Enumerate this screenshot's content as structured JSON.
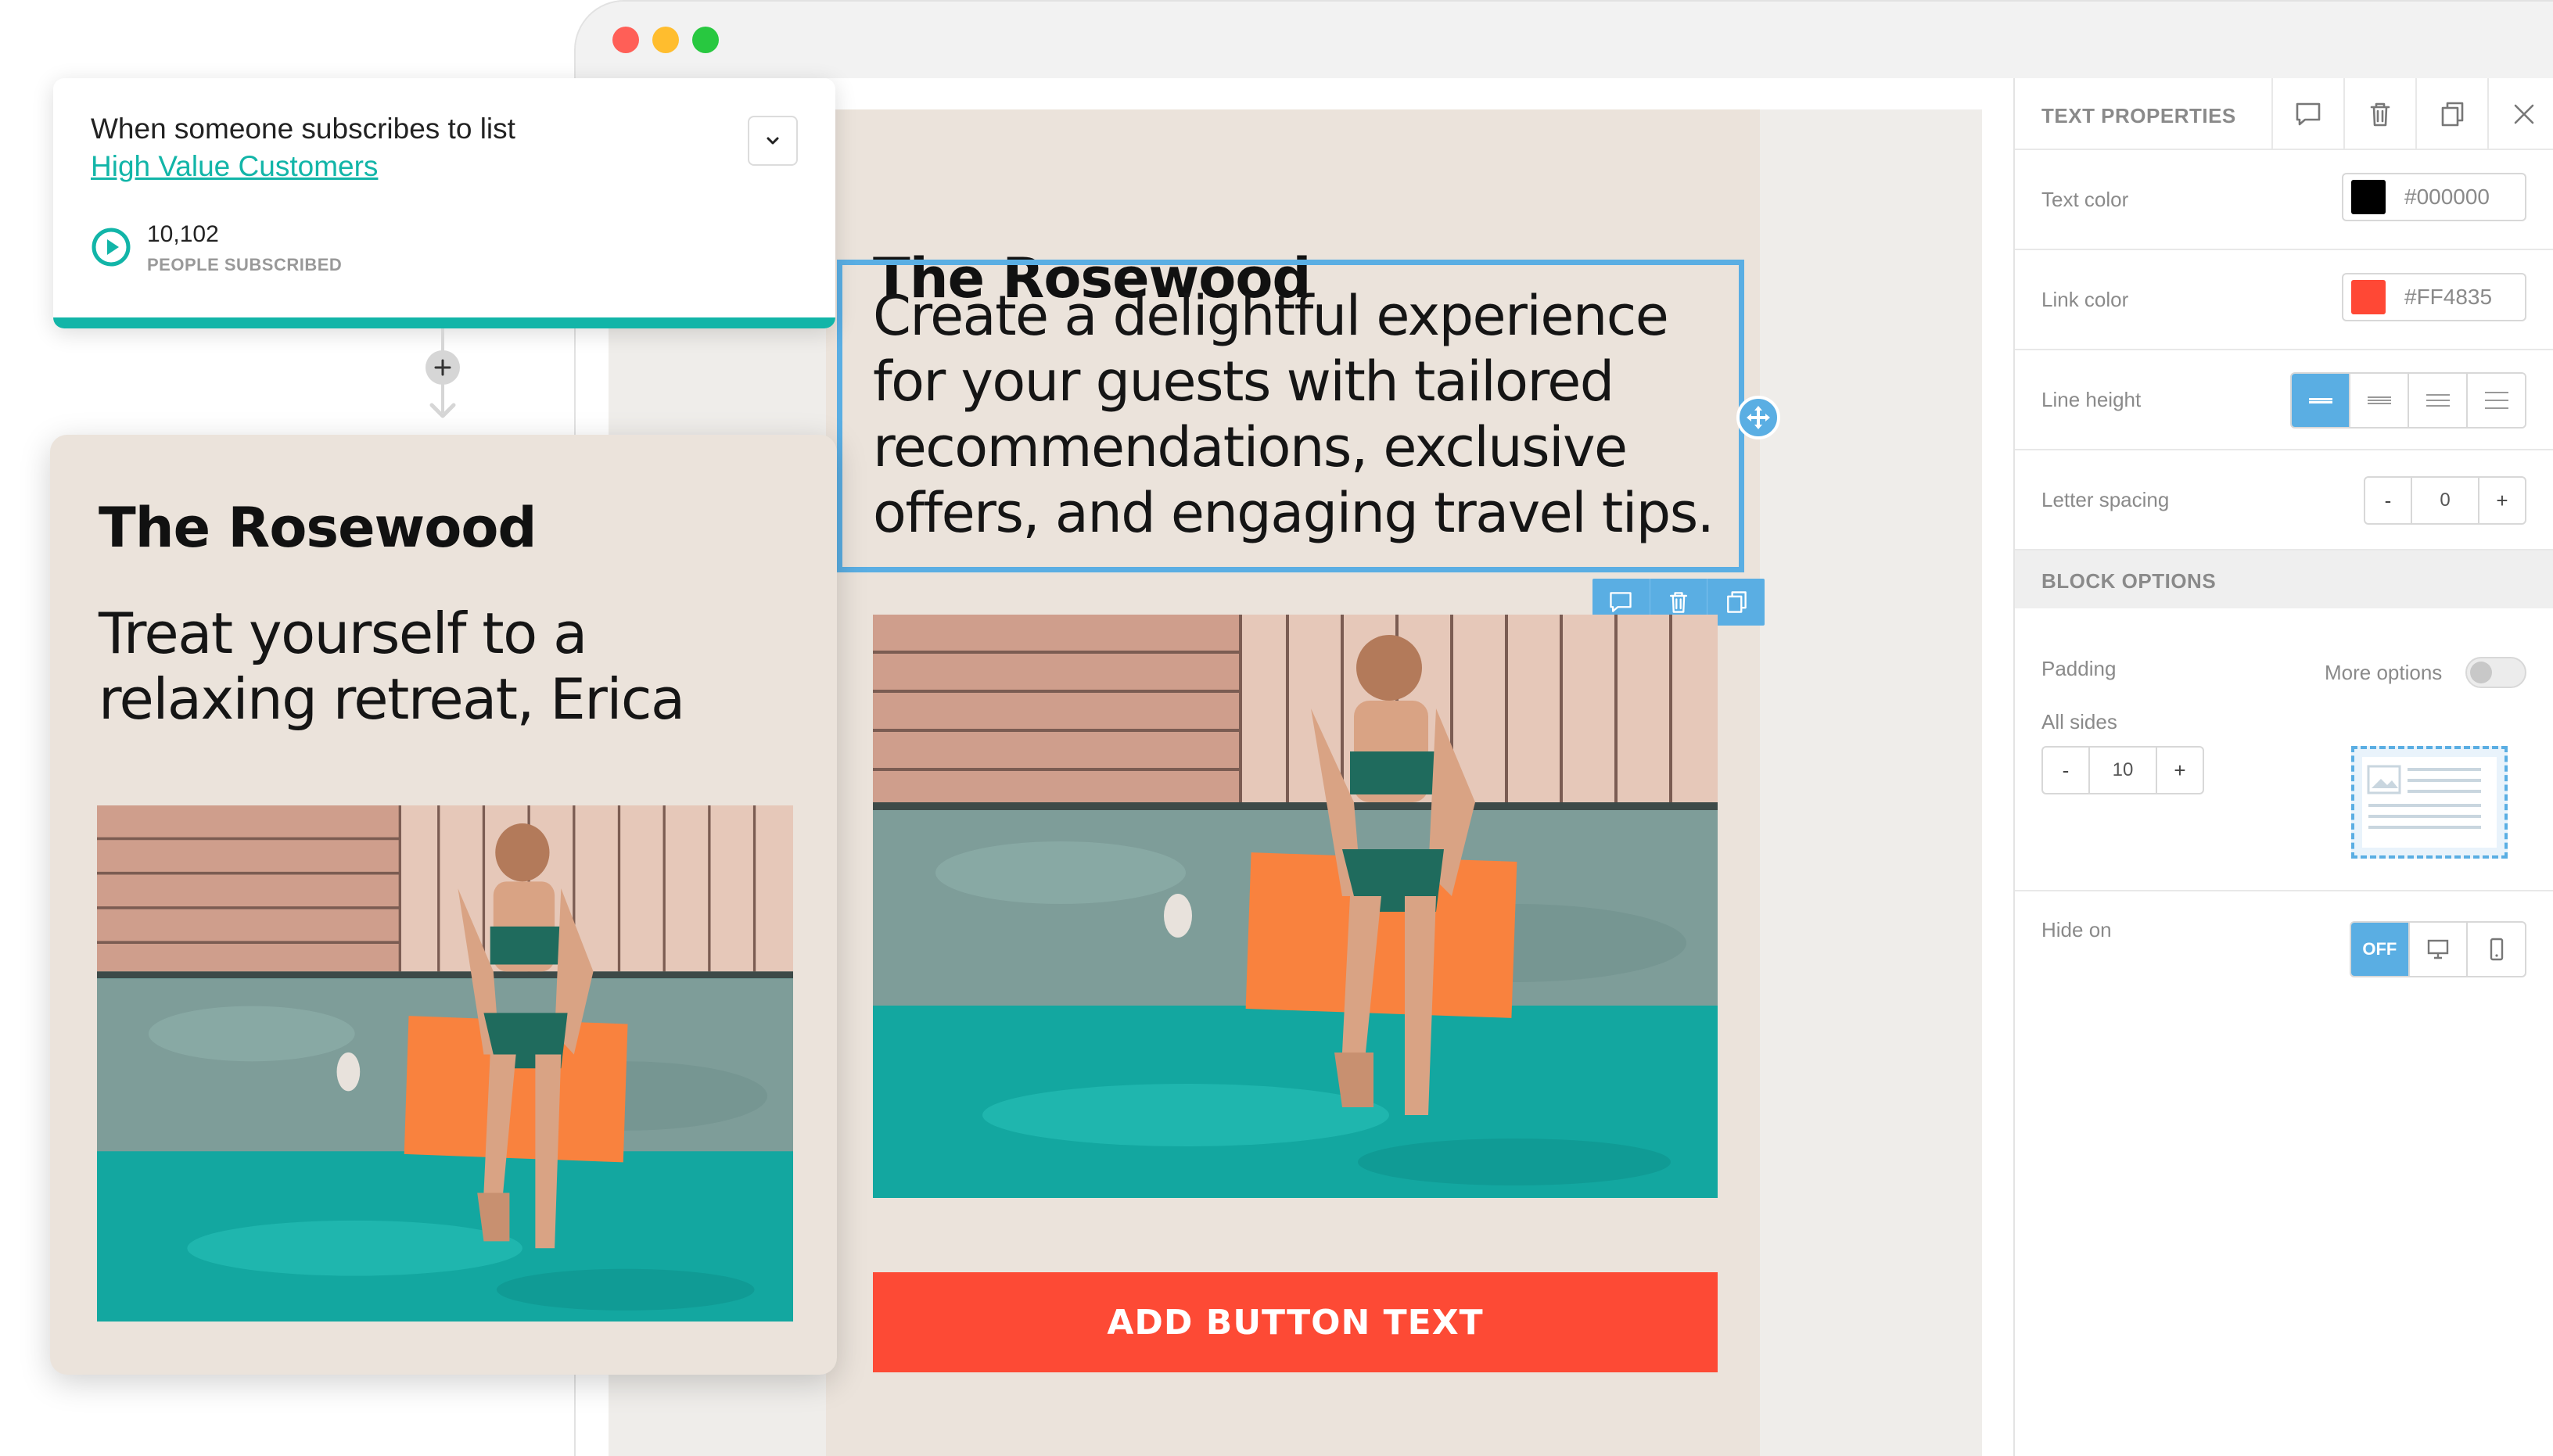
{
  "trigger": {
    "line1": "When someone subscribes to list",
    "list_name": "High Value Customers",
    "count": "10,102",
    "count_label": "PEOPLE SUBSCRIBED"
  },
  "preview": {
    "title": "The Rosewood",
    "body": "Treat yourself to a relaxing retreat, Erica"
  },
  "email": {
    "title": "The Rosewood",
    "body": "Create a delightful experience for your guests with tailored recommendations, exclusive offers, and engaging travel tips.",
    "button_label": "ADD BUTTON TEXT"
  },
  "panel": {
    "title": "TEXT PROPERTIES",
    "text_color": {
      "label": "Text color",
      "value": "#000000",
      "swatch": "#000000"
    },
    "link_color": {
      "label": "Link color",
      "value": "#FF4835",
      "swatch": "#FF4835"
    },
    "line_height": {
      "label": "Line height",
      "selected_index": 0
    },
    "letter_spacing": {
      "label": "Letter spacing",
      "minus": "-",
      "value": "0",
      "plus": "+"
    },
    "block_options": "BLOCK OPTIONS",
    "padding": {
      "label": "Padding",
      "more_options": "More options",
      "all_sides": "All sides",
      "minus": "-",
      "value": "10",
      "plus": "+"
    },
    "hide_on": {
      "label": "Hide on",
      "off_label": "OFF"
    }
  },
  "colors": {
    "accent_blue": "#5AAEE3",
    "teal": "#12B5A8",
    "cta_red": "#FD4A35",
    "email_bg": "#EBE3DB"
  },
  "icons": [
    "comment-icon",
    "trash-icon",
    "copy-icon",
    "close-icon",
    "move-icon",
    "chevron-down-icon",
    "play-circle-icon",
    "plus-icon",
    "desktop-icon",
    "mobile-icon",
    "image-placeholder-icon"
  ]
}
